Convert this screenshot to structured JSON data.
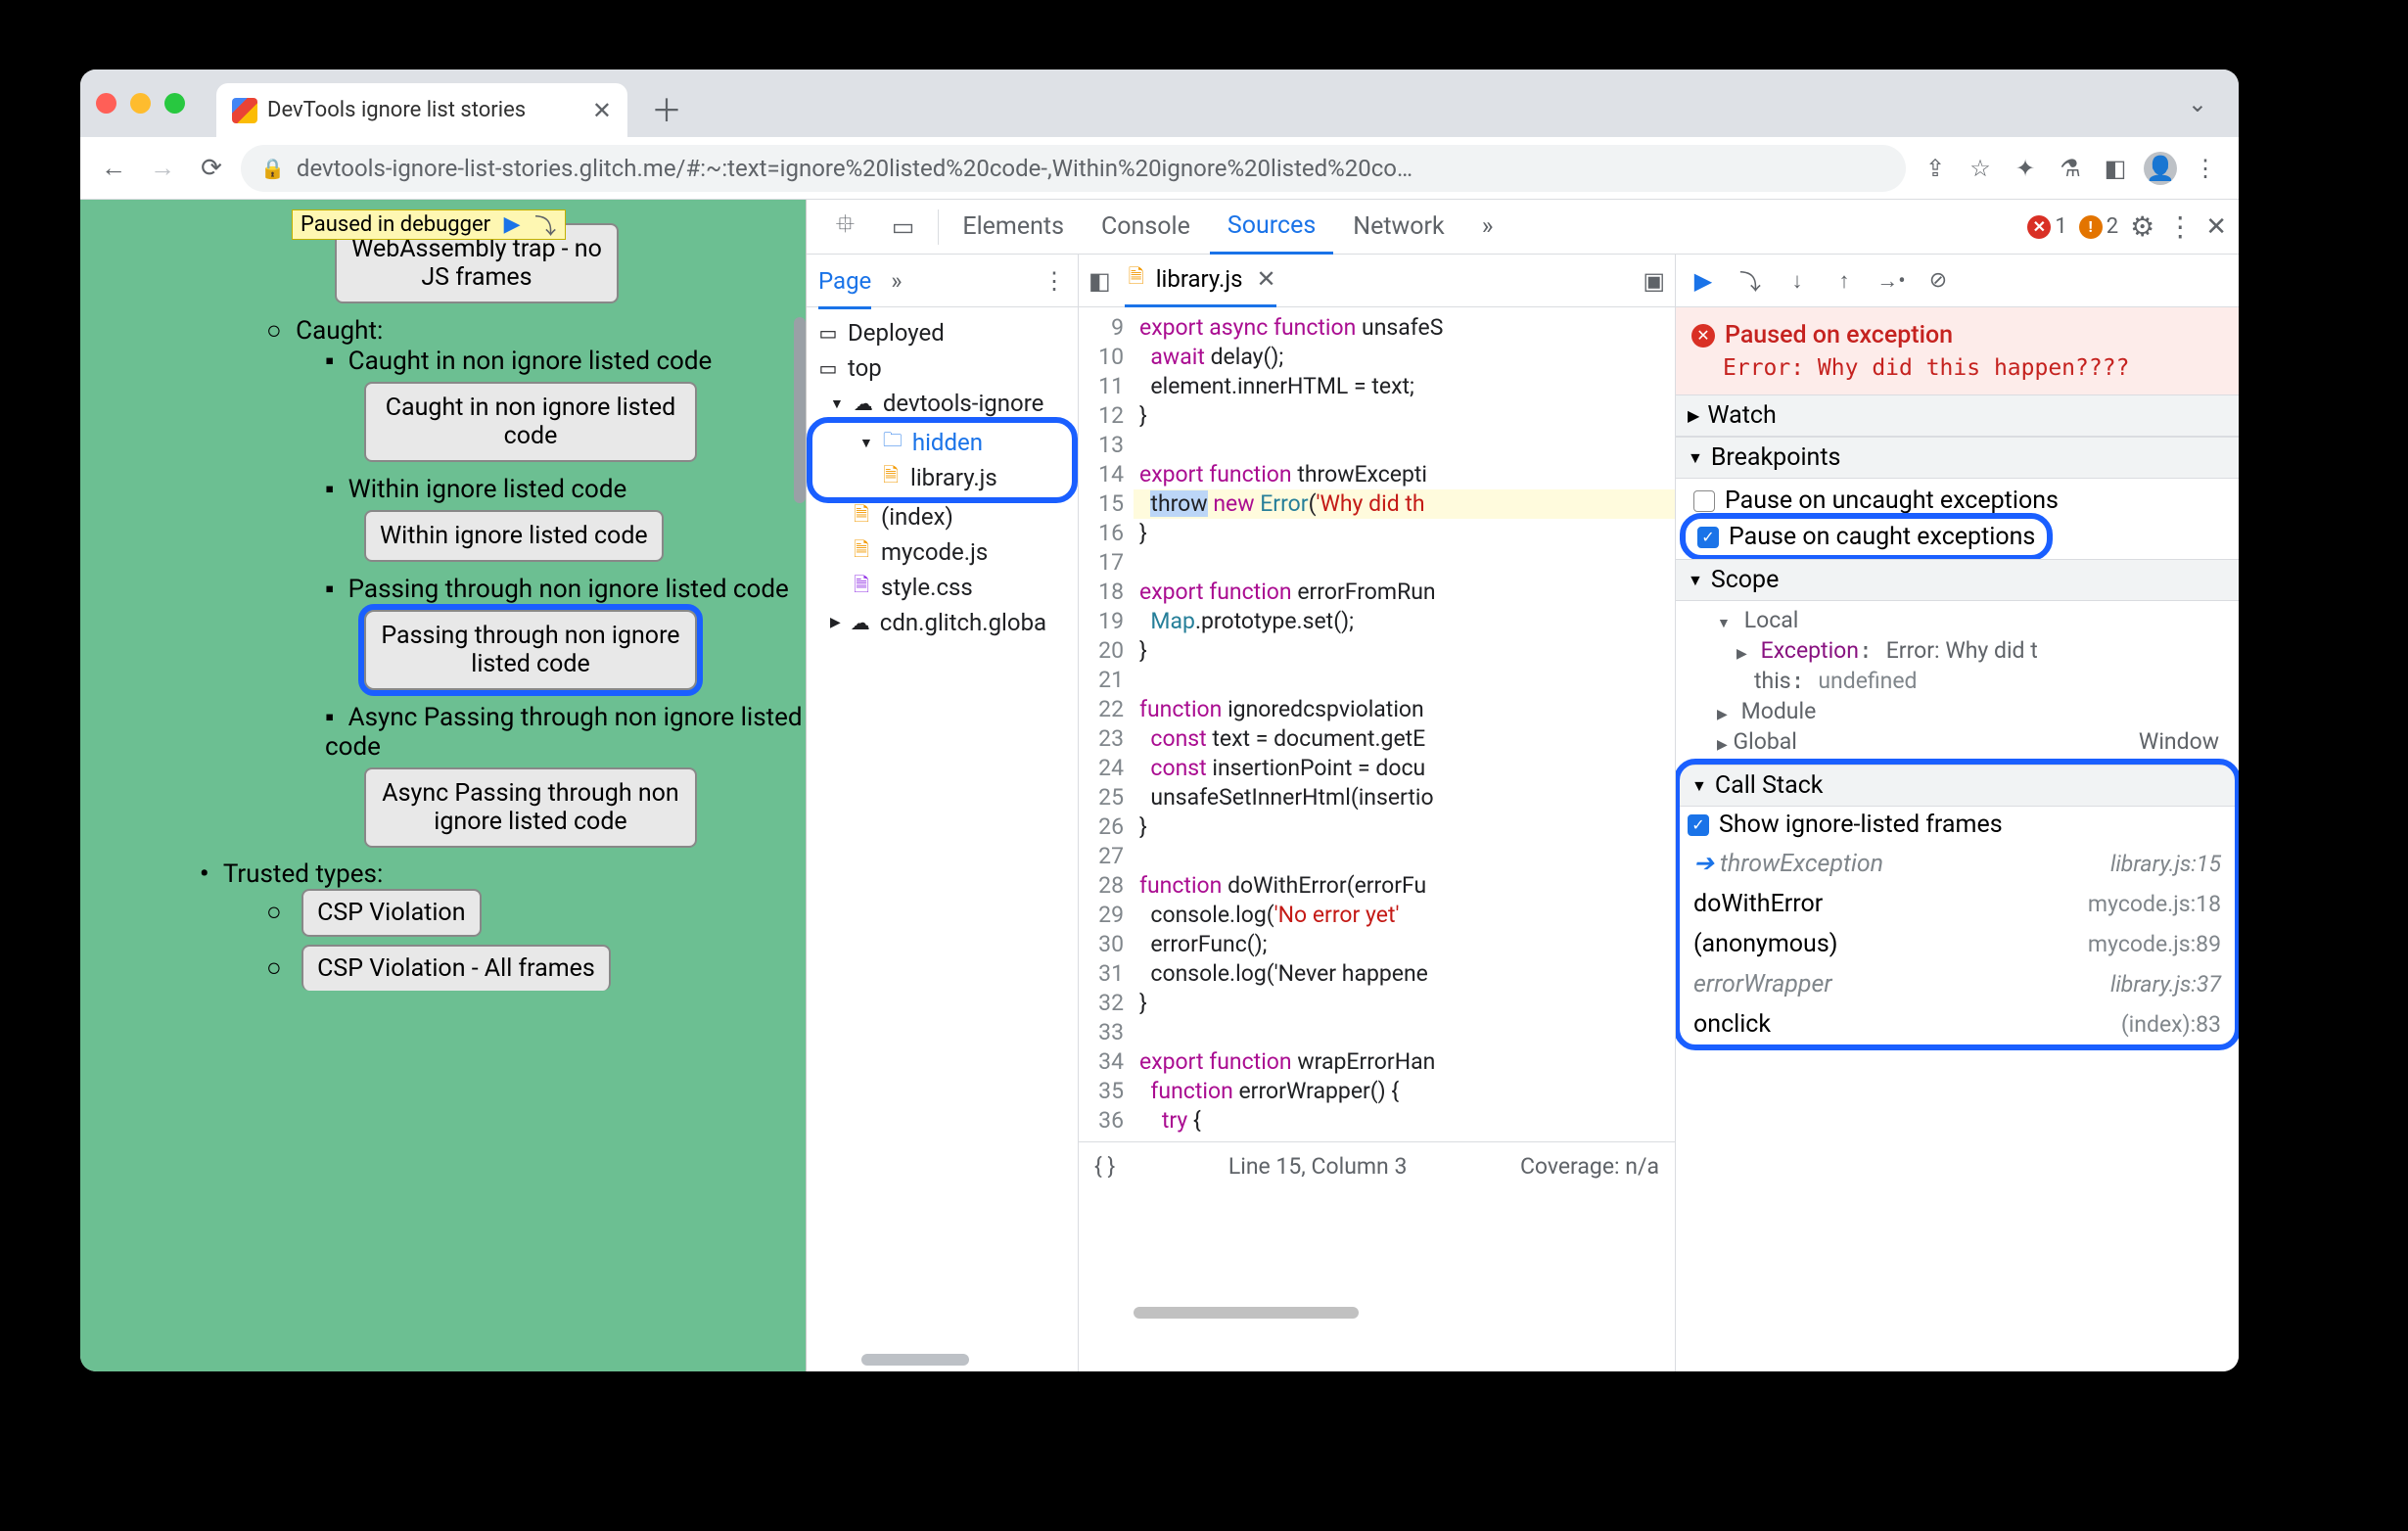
{
  "browser": {
    "tab_title": "DevTools ignore list stories",
    "url_display": "devtools-ignore-list-stories.glitch.me/#:~:text=ignore%20listed%20code-,Within%20ignore%20listed%20co…"
  },
  "paused_overlay": {
    "text": "Paused in debugger"
  },
  "page": {
    "partial_btn_top": "WebAssembly trap - no JS frames",
    "caught_label": "Caught:",
    "items": [
      {
        "label": "Caught in non ignore listed code",
        "btn": "Caught in non ignore listed code"
      },
      {
        "label": "Within ignore listed code",
        "btn": "Within ignore listed code"
      },
      {
        "label": "Passing through non ignore listed code",
        "btn": "Passing through non ignore listed code",
        "hl": true
      },
      {
        "label": "Async Passing through non ignore listed code",
        "btn": "Async Passing through non ignore listed code"
      }
    ],
    "trusted_label": "Trusted types:",
    "trusted": [
      {
        "btn": "CSP Violation"
      },
      {
        "btn": "CSP Violation - All frames"
      }
    ]
  },
  "devtools": {
    "tabs": {
      "elements": "Elements",
      "console": "Console",
      "sources": "Sources",
      "network": "Network",
      "more": "»"
    },
    "errors": {
      "err_count": "1",
      "warn_count": "2"
    },
    "nav": {
      "page": "Page",
      "more": "»",
      "tree": {
        "deployed": "Deployed",
        "top": "top",
        "site": "devtools-ignore",
        "hidden": "hidden",
        "libjs": "library.js",
        "index": "(index)",
        "mycode": "mycode.js",
        "style": "style.css",
        "cdn": "cdn.glitch.globa"
      }
    },
    "editor": {
      "file": "library.js",
      "first_line": 9,
      "lines": [
        "export async function unsafeS",
        "  await delay();",
        "  element.innerHTML = text;",
        "}",
        "",
        "export function throwExcepti",
        "  throw new Error('Why did th",
        "}",
        "",
        "export function errorFromRun",
        "  Map.prototype.set();",
        "}",
        "",
        "function ignoredcspviolation",
        "  const text = document.getE",
        "  const insertionPoint = docu",
        "  unsafeSetInnerHtml(insertio",
        "}",
        "",
        "function doWithError(errorFu",
        "  console.log('No error yet'",
        "  errorFunc();",
        "  console.log('Never happene",
        "}",
        "",
        "export function wrapErrorHan",
        "  function errorWrapper() {",
        "    try {"
      ],
      "status_line": "Line 15, Column 3",
      "coverage": "Coverage: n/a"
    },
    "debugger": {
      "banner_title": "Paused on exception",
      "banner_msg": "Error: Why did this happen????",
      "watch": "Watch",
      "breakpoints": {
        "title": "Breakpoints",
        "uncaught": "Pause on uncaught exceptions",
        "caught": "Pause on caught exceptions"
      },
      "scope": {
        "title": "Scope",
        "local": "Local",
        "exception_k": "Exception",
        "exception_v": "Error: Why did t",
        "this_k": "this",
        "this_v": "undefined",
        "module": "Module",
        "global": "Global",
        "global_v": "Window"
      },
      "callstack": {
        "title": "Call Stack",
        "show_ignored": "Show ignore-listed frames",
        "frames": [
          {
            "name": "throwException",
            "loc": "library.js:15",
            "ignored": true,
            "current": true
          },
          {
            "name": "doWithError",
            "loc": "mycode.js:18"
          },
          {
            "name": "(anonymous)",
            "loc": "mycode.js:89"
          },
          {
            "name": "errorWrapper",
            "loc": "library.js:37",
            "ignored": true
          },
          {
            "name": "onclick",
            "loc": "(index):83"
          }
        ]
      }
    }
  }
}
